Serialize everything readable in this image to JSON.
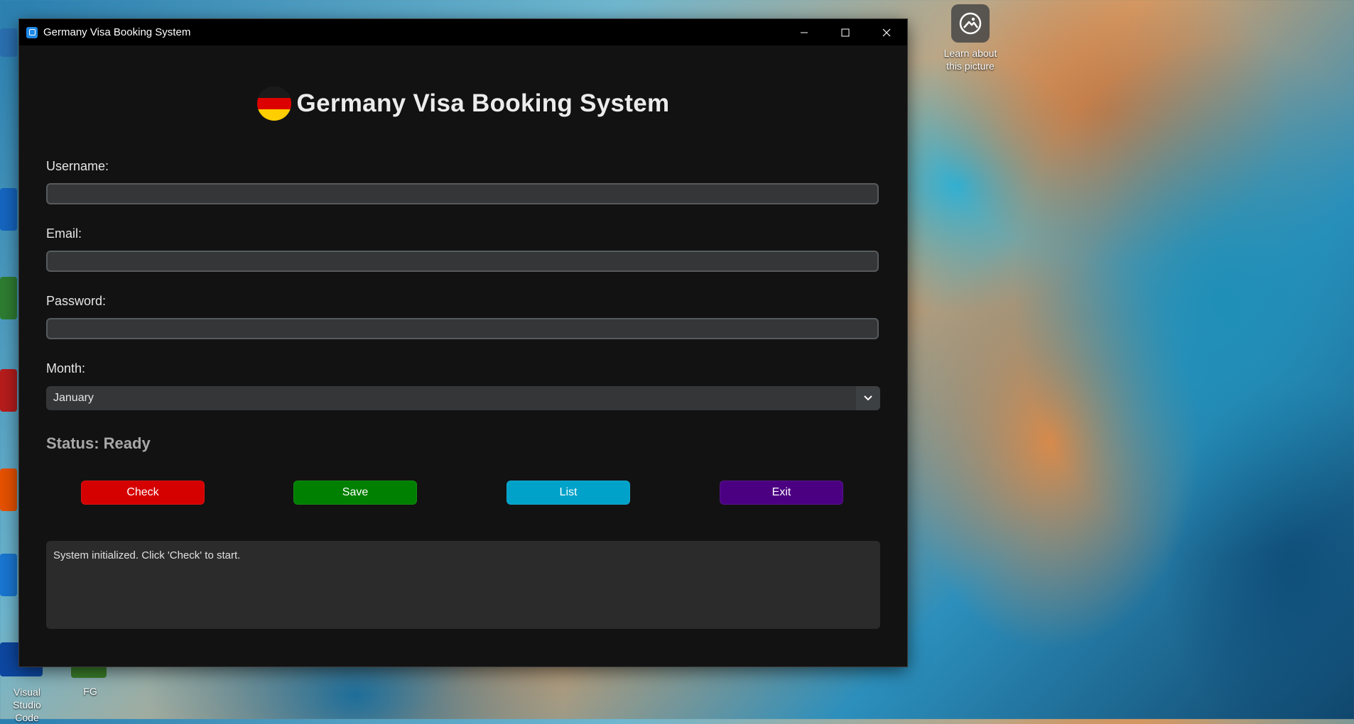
{
  "window": {
    "title": "Germany Visa Booking System"
  },
  "desktop": {
    "learn_label": "Learn about this picture",
    "icon_vscode": "Visual Studio Code",
    "icon_fg": "FG"
  },
  "app": {
    "heading": "Germany Visa Booking System",
    "username_label": "Username:",
    "username_value": "",
    "email_label": "Email:",
    "email_value": "",
    "password_label": "Password:",
    "password_value": "",
    "month_label": "Month:",
    "month_selected": "January",
    "status": "Status: Ready",
    "buttons": {
      "check": "Check",
      "save": "Save",
      "list": "List",
      "exit": "Exit"
    },
    "log_text": "System initialized. Click 'Check' to start."
  },
  "colors": {
    "check": "#d50000",
    "save": "#008000",
    "list": "#00a2c9",
    "exit": "#4b0082",
    "flag_black": "#1a1a1a",
    "flag_red": "#dd0000",
    "flag_gold": "#ffce00"
  }
}
